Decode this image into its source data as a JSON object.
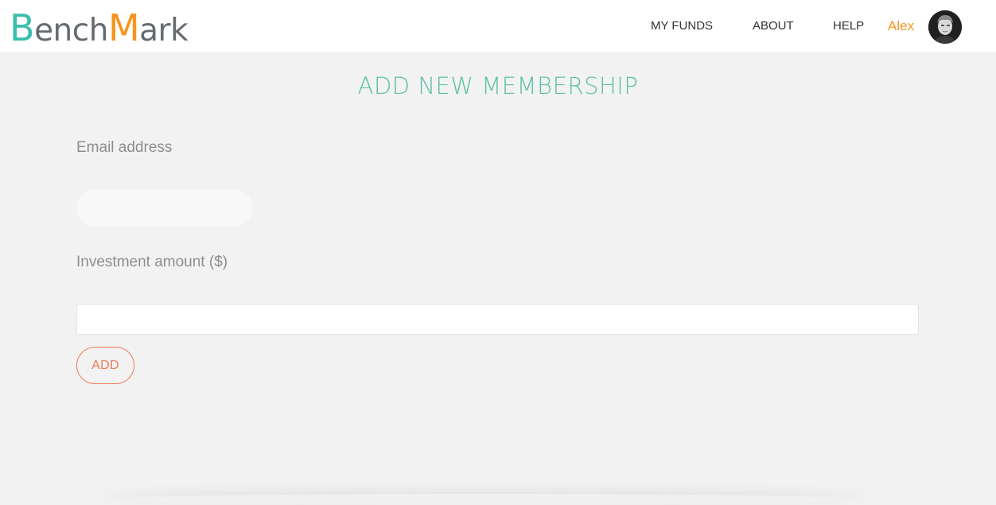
{
  "header": {
    "logo": {
      "b": "B",
      "ench": "ench",
      "m": "M",
      "ark": "ark"
    },
    "nav": {
      "my_funds": "MY FUNDS",
      "about": "ABOUT",
      "help": "HELP"
    },
    "user": {
      "name": "Alex"
    }
  },
  "main": {
    "title": "ADD NEW MEMBERSHIP",
    "email_label": "Email address",
    "email_value": "",
    "amount_label": "Investment amount ($)",
    "amount_value": "",
    "add_button": "ADD"
  },
  "colors": {
    "brand_teal": "#3bbfad",
    "brand_orange": "#f7941d",
    "title_teal": "#5cbfa5",
    "button_orange": "#ee7b5a",
    "background": "#f2f2f2"
  }
}
